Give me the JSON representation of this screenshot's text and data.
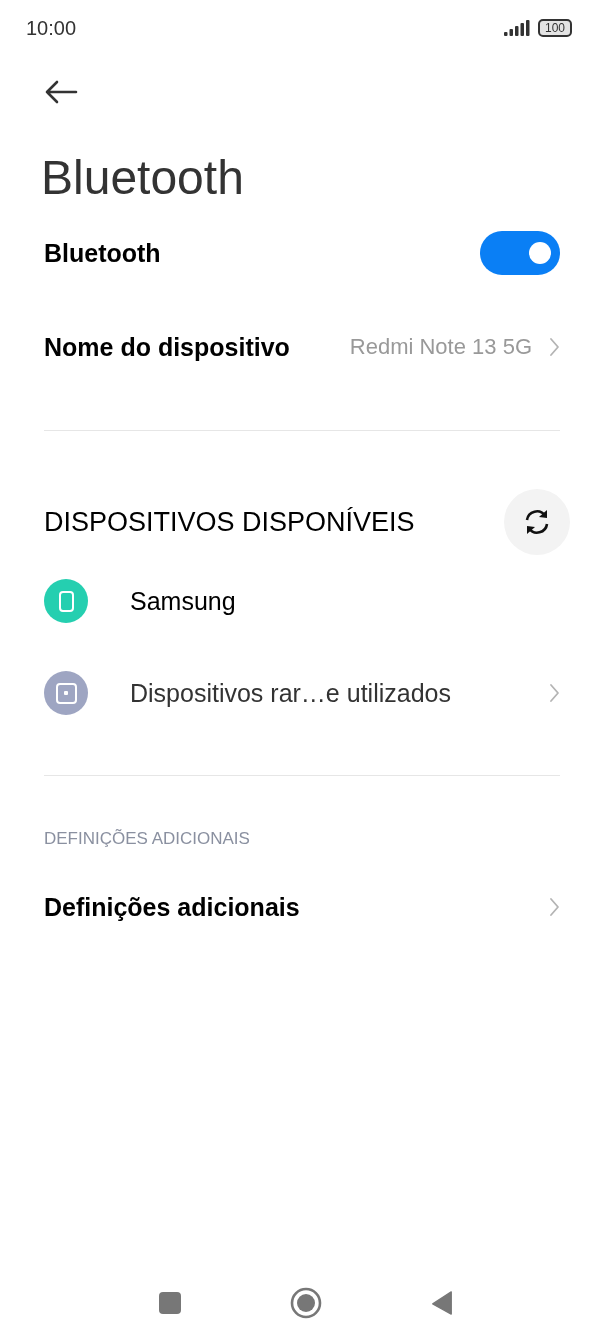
{
  "status_bar": {
    "time": "10:00",
    "battery": "100"
  },
  "title": "Bluetooth",
  "toggle_row": {
    "label": "Bluetooth",
    "on": true
  },
  "device_name_row": {
    "label": "Nome do dispositivo",
    "value": "Redmi Note 13 5G"
  },
  "available_section": {
    "heading": "DISPOSITIVOS DISPONÍVEIS",
    "devices": [
      {
        "kind": "device",
        "name": "Samsung",
        "color": "#25cfb0"
      },
      {
        "kind": "link",
        "name": "Dispositivos rar…e utilizados",
        "color": "#9ea5c2"
      }
    ]
  },
  "additional_section": {
    "heading": "DEFINIÇÕES ADICIONAIS",
    "items": [
      {
        "label": "Definições adicionais"
      }
    ]
  }
}
